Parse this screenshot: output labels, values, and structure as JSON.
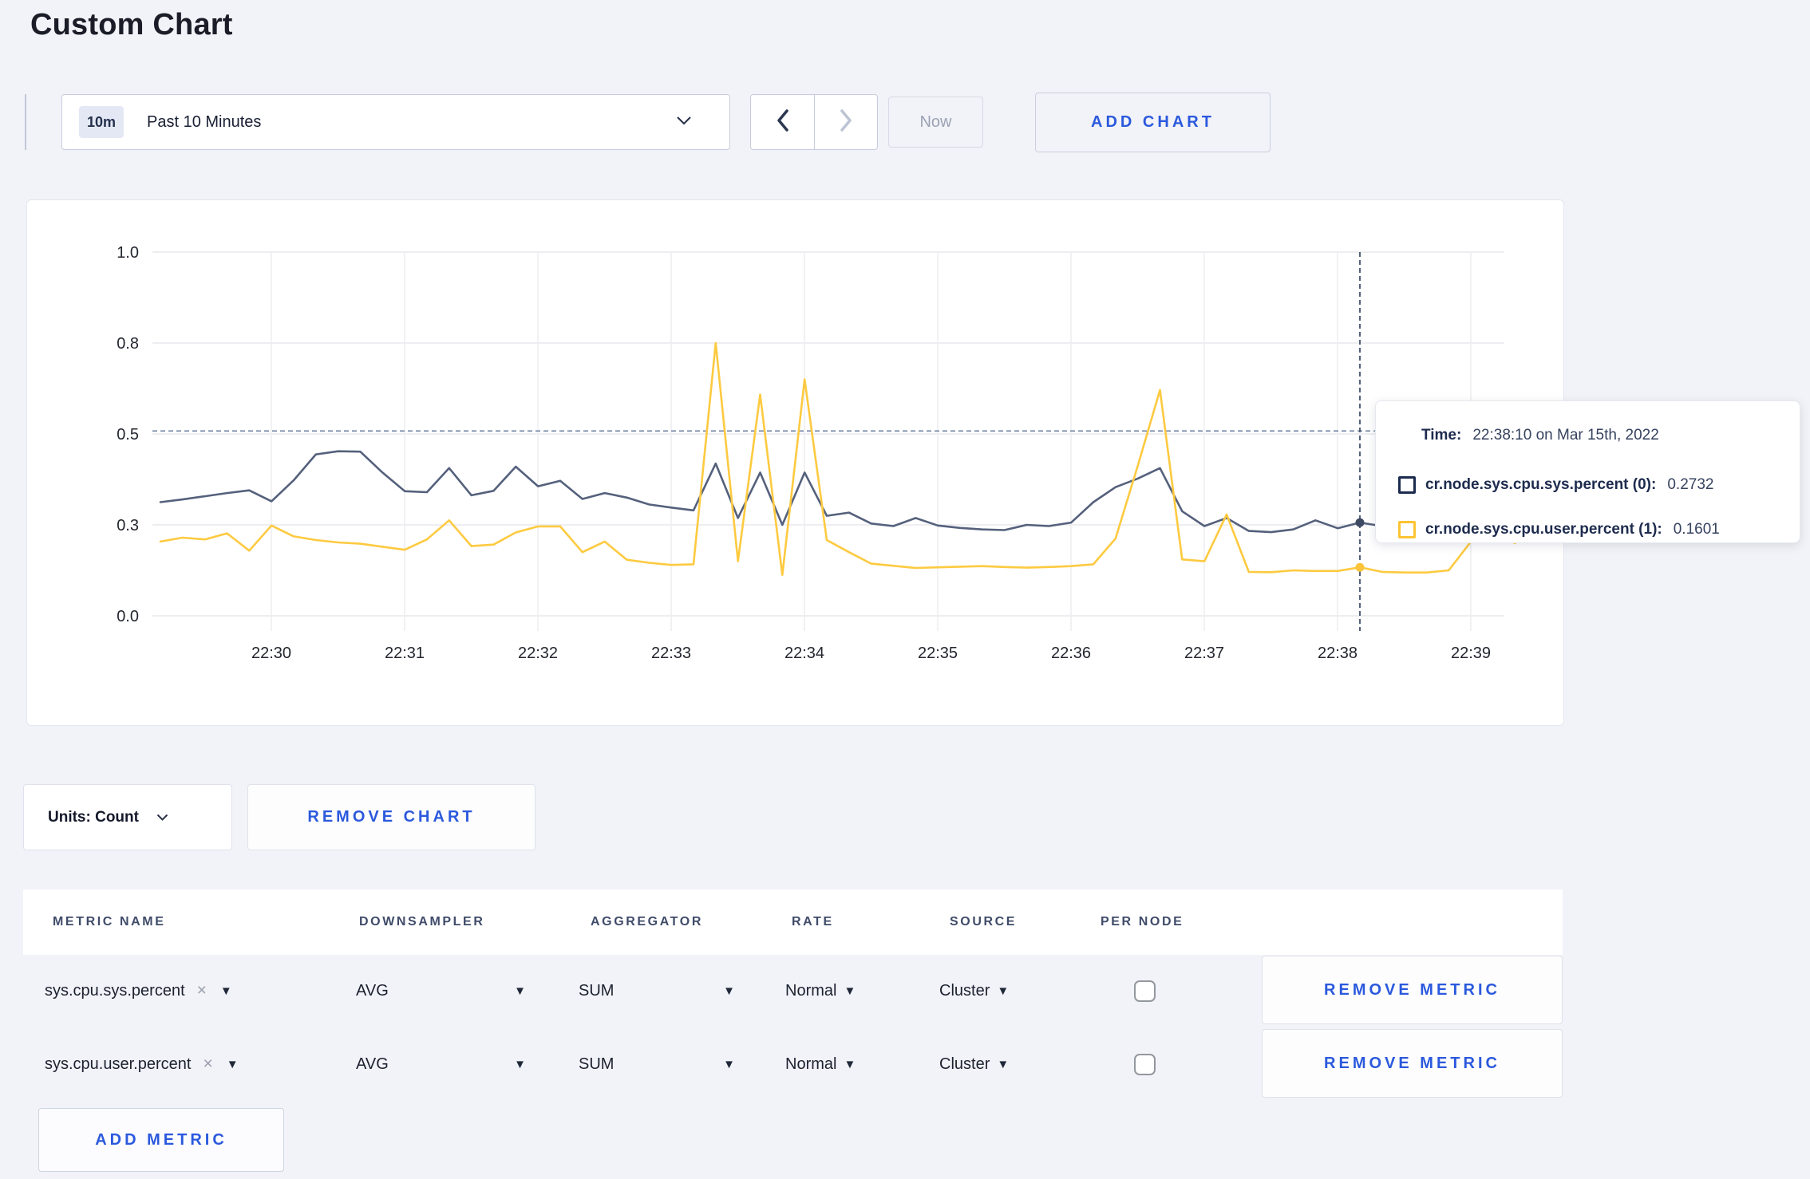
{
  "page": {
    "title": "Custom Chart",
    "accent_blue": "#2b59dd",
    "background": "#f2f3f8"
  },
  "toolbar": {
    "time_badge": "10m",
    "time_label": "Past 10 Minutes",
    "now_label": "Now",
    "add_chart_label": "ADD CHART"
  },
  "chart": {
    "tooltip": {
      "time_label": "Time:",
      "time_value": "22:38:10 on Mar 15th, 2022",
      "series": [
        {
          "label": "cr.node.sys.cpu.sys.percent (0):",
          "value": "0.2732",
          "color": "#1c2b4f"
        },
        {
          "label": "cr.node.sys.cpu.user.percent (1):",
          "value": "0.1601",
          "color": "#fcc433"
        }
      ]
    }
  },
  "chart_data": {
    "type": "line",
    "title": "",
    "xlabel": "",
    "ylabel": "",
    "ylim": [
      0,
      1.0
    ],
    "grid": true,
    "legend_position": "none",
    "y_ticks": {
      "values": [
        0,
        0.3,
        0.5,
        0.8,
        1.0
      ],
      "labels": [
        "0.0",
        "0.3",
        "0.5",
        "0.8",
        "1.0"
      ]
    },
    "x_tick_labels": [
      "22:30",
      "22:31",
      "22:32",
      "22:33",
      "22:34",
      "22:35",
      "22:36",
      "22:37",
      "22:38",
      "22:39"
    ],
    "x_start": "22:29:10",
    "x_step_seconds": 10,
    "crosshair": {
      "index": 54,
      "time": "22:38:10",
      "hline_value": 0.51
    },
    "series": [
      {
        "name": "cr.node.sys.cpu.sys.percent",
        "color": "#55617c",
        "dot_color": "#3e4a64",
        "values": [
          0.35,
          0.356,
          0.363,
          0.37,
          0.376,
          0.352,
          0.398,
          0.455,
          0.462,
          0.461,
          0.415,
          0.374,
          0.372,
          0.425,
          0.365,
          0.375,
          0.428,
          0.385,
          0.397,
          0.357,
          0.37,
          0.36,
          0.345,
          0.338,
          0.332,
          0.435,
          0.315,
          0.415,
          0.3,
          0.415,
          0.32,
          0.327,
          0.303,
          0.296,
          0.315,
          0.298,
          0.29,
          0.285,
          0.283,
          0.3,
          0.296,
          0.305,
          0.35,
          0.383,
          0.402,
          0.425,
          0.33,
          0.296,
          0.315,
          0.28,
          0.276,
          0.285,
          0.31,
          0.289,
          0.305,
          0.296,
          0.291,
          0.289,
          0.293,
          0.3,
          0.297,
          0.3
        ]
      },
      {
        "name": "cr.node.sys.cpu.user.percent",
        "color": "#fdca40",
        "dot_color": "#fcc43b",
        "values": [
          0.245,
          0.258,
          0.252,
          0.272,
          0.215,
          0.298,
          0.262,
          0.25,
          0.242,
          0.238,
          0.228,
          0.218,
          0.252,
          0.31,
          0.23,
          0.235,
          0.275,
          0.295,
          0.295,
          0.21,
          0.245,
          0.185,
          0.175,
          0.168,
          0.17,
          0.8,
          0.18,
          0.63,
          0.135,
          0.68,
          0.25,
          0.21,
          0.172,
          0.165,
          0.158,
          0.16,
          0.162,
          0.164,
          0.161,
          0.159,
          0.161,
          0.164,
          0.17,
          0.255,
          0.43,
          0.645,
          0.186,
          0.18,
          0.323,
          0.145,
          0.144,
          0.15,
          0.148,
          0.148,
          0.16,
          0.145,
          0.143,
          0.143,
          0.15,
          0.245,
          0.262,
          0.24
        ]
      }
    ]
  },
  "units_bar": {
    "units_label": "Units: Count",
    "remove_chart_label": "REMOVE CHART"
  },
  "metrics_table": {
    "headers": [
      "METRIC NAME",
      "DOWNSAMPLER",
      "AGGREGATOR",
      "RATE",
      "SOURCE",
      "PER NODE"
    ],
    "remove_metric_label": "REMOVE METRIC",
    "add_metric_label": "ADD METRIC",
    "rows": [
      {
        "metric": "sys.cpu.sys.percent",
        "downsampler": "AVG",
        "aggregator": "SUM",
        "rate": "Normal",
        "source": "Cluster",
        "per_node": false,
        "remove_label": "REMOVE METRIC"
      },
      {
        "metric": "sys.cpu.user.percent",
        "downsampler": "AVG",
        "aggregator": "SUM",
        "rate": "Normal",
        "source": "Cluster",
        "per_node": false,
        "remove_label": "REMOVE METRIC"
      }
    ]
  }
}
